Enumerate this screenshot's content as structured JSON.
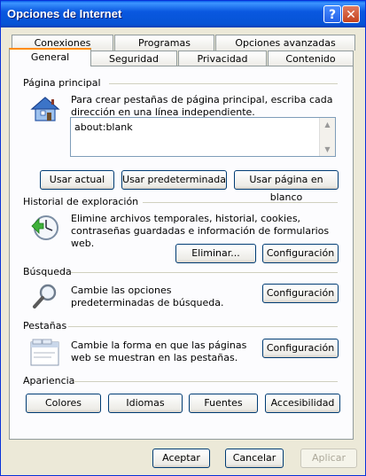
{
  "window": {
    "title": "Opciones de Internet",
    "help_glyph": "?",
    "close_glyph": "✕"
  },
  "tabs_top": [
    "Conexiones",
    "Programas",
    "Opciones avanzadas"
  ],
  "tabs_bottom": [
    "General",
    "Seguridad",
    "Privacidad",
    "Contenido"
  ],
  "home": {
    "section": "Página principal",
    "description": "Para crear pestañas de página principal, escriba cada dirección en una línea independiente.",
    "value": "about:blank",
    "buttons": [
      "Usar actual",
      "Usar predeterminada",
      "Usar página en blanco"
    ]
  },
  "history": {
    "section": "Historial de exploración",
    "description": "Elimine archivos temporales, historial, cookies, contraseñas guardadas e información de formularios web.",
    "delete_button": "Eliminar...",
    "settings_button": "Configuración"
  },
  "search": {
    "section": "Búsqueda",
    "description": "Cambie las opciones predeterminadas de búsqueda.",
    "settings_button": "Configuración"
  },
  "tabs_section": {
    "section": "Pestañas",
    "description": "Cambie la forma en que las páginas web se muestran en las pestañas.",
    "settings_button": "Configuración"
  },
  "appearance": {
    "section": "Apariencia",
    "buttons": [
      "Colores",
      "Idiomas",
      "Fuentes",
      "Accesibilidad"
    ]
  },
  "footer": {
    "ok": "Aceptar",
    "cancel": "Cancelar",
    "apply": "Aplicar"
  }
}
